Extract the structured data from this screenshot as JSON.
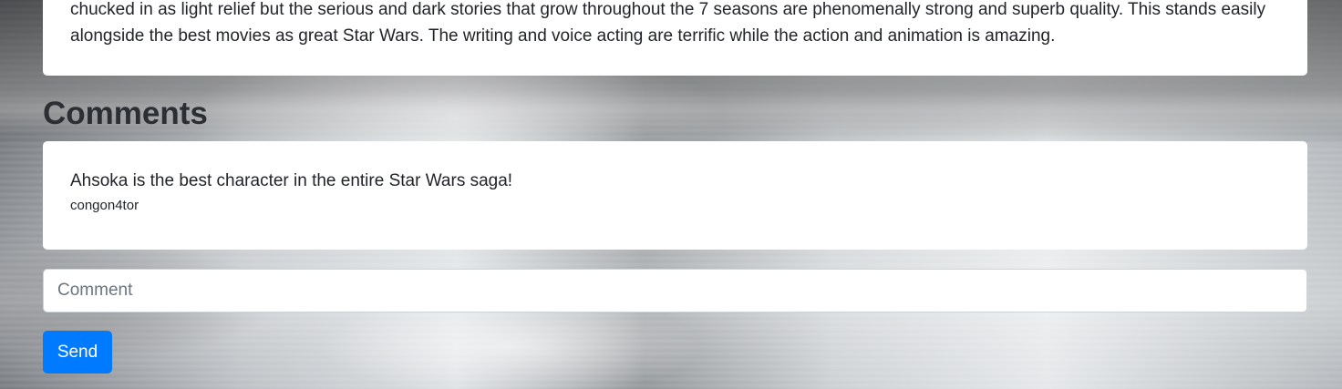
{
  "review": {
    "text": "chucked in as light relief but the serious and dark stories that grow throughout the 7 seasons are phenomenally strong and superb quality. This stands easily alongside the best movies as great Star Wars. The writing and voice acting are terrific while the action and animation is amazing."
  },
  "comments": {
    "heading": "Comments",
    "items": [
      {
        "body": "Ahsoka is the best character in the entire Star Wars saga!",
        "author": "congon4tor"
      }
    ],
    "input": {
      "placeholder": "Comment",
      "value": ""
    },
    "send_label": "Send"
  },
  "colors": {
    "primary_button": "#007bff",
    "card_background": "#ffffff",
    "text": "#212529"
  }
}
